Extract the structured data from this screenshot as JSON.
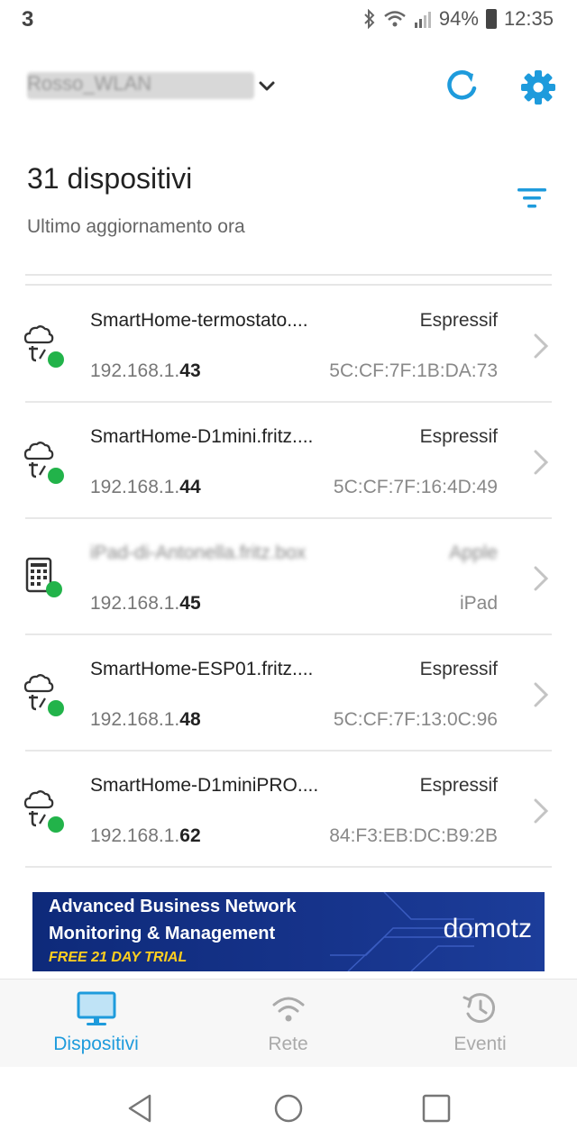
{
  "status_bar": {
    "carrier": "3",
    "battery": "94%",
    "time": "12:35"
  },
  "header": {
    "network_name": "Rosso_WLAN"
  },
  "summary": {
    "device_count": "31 dispositivi",
    "last_update": "Ultimo aggiornamento ora"
  },
  "devices": [
    {
      "name": "SmartHome-termostato....",
      "vendor": "Espressif",
      "ip_prefix": "192.168.1.",
      "ip_suffix": "43",
      "detail": "5C:CF:7F:1B:DA:73",
      "icon": "iot-cloud-icon",
      "blurred": false
    },
    {
      "name": "SmartHome-D1mini.fritz....",
      "vendor": "Espressif",
      "ip_prefix": "192.168.1.",
      "ip_suffix": "44",
      "detail": "5C:CF:7F:16:4D:49",
      "icon": "iot-cloud-icon",
      "blurred": false
    },
    {
      "name": "iPad-di-Antonella.fritz.box",
      "vendor": "Apple",
      "ip_prefix": "192.168.1.",
      "ip_suffix": "45",
      "detail": "iPad",
      "icon": "tablet-icon",
      "blurred": true
    },
    {
      "name": "SmartHome-ESP01.fritz....",
      "vendor": "Espressif",
      "ip_prefix": "192.168.1.",
      "ip_suffix": "48",
      "detail": "5C:CF:7F:13:0C:96",
      "icon": "iot-cloud-icon",
      "blurred": false
    },
    {
      "name": "SmartHome-D1miniPRO....",
      "vendor": "Espressif",
      "ip_prefix": "192.168.1.",
      "ip_suffix": "62",
      "detail": "84:F3:EB:DC:B9:2B",
      "icon": "iot-cloud-icon",
      "blurred": false
    }
  ],
  "ad": {
    "line1": "Advanced Business Network",
    "line2": "Monitoring & Management",
    "line3": "FREE 21 DAY TRIAL",
    "brand": "domotz"
  },
  "bottom_nav": {
    "items": [
      {
        "label": "Dispositivi",
        "icon": "monitor-icon",
        "active": true
      },
      {
        "label": "Rete",
        "icon": "wifi-icon",
        "active": false
      },
      {
        "label": "Eventi",
        "icon": "history-icon",
        "active": false
      }
    ]
  },
  "colors": {
    "accent": "#1e9bdc",
    "online": "#22b34a",
    "ad_background": "#16338a",
    "ad_highlight": "#ffcf1f"
  }
}
